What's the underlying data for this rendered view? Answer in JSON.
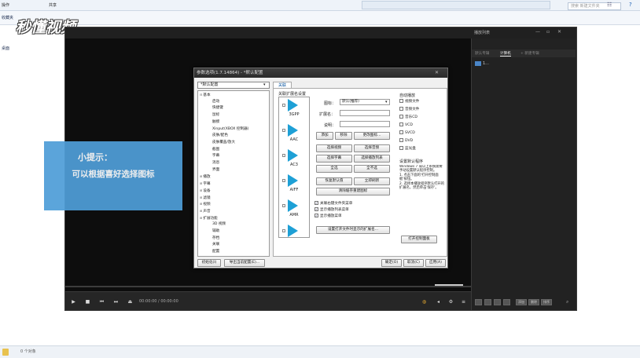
{
  "explorer": {
    "tab_left": "操作",
    "tab_mid": "共享",
    "nav_fav": "收藏夹",
    "nav_desktop": "桌面",
    "search_placeholder": "搜索 新建文件夹",
    "status": "0 个对象"
  },
  "watermark": "秒懂视频",
  "player": {
    "time": "00:00:00 / 00:00:00",
    "playlist_header": "播放列表",
    "playlist_tabs": [
      "默认专辑",
      "计算机",
      "+ 新建专辑"
    ],
    "playlist_item": "1...",
    "pl_buttons": [
      "添加",
      "删除",
      "排序"
    ]
  },
  "dialog": {
    "title": "参数选项(1.7.14864) - *默认配置",
    "preset": "*默认配置",
    "tree": [
      {
        "label": "基本",
        "cls": "open"
      },
      {
        "label": "启动",
        "cls": ""
      },
      {
        "label": "快捷键",
        "cls": ""
      },
      {
        "label": "鼠标",
        "cls": ""
      },
      {
        "label": "触摸",
        "cls": ""
      },
      {
        "label": "Xinput(XBOX 控制器)",
        "cls": ""
      },
      {
        "label": "皮肤/配色",
        "cls": ""
      },
      {
        "label": "皮肤覆盖/放大",
        "cls": ""
      },
      {
        "label": "截图",
        "cls": ""
      },
      {
        "label": "字幕",
        "cls": ""
      },
      {
        "label": "消息",
        "cls": ""
      },
      {
        "label": "界面",
        "cls": ""
      },
      {
        "label": "播放",
        "cls": "top"
      },
      {
        "label": "字幕",
        "cls": "top"
      },
      {
        "label": "设备",
        "cls": "top"
      },
      {
        "label": "滤镜",
        "cls": "top"
      },
      {
        "label": "视频",
        "cls": "top"
      },
      {
        "label": "声音",
        "cls": "top"
      },
      {
        "label": "扩展功能",
        "cls": "top"
      },
      {
        "label": "3D 视频",
        "cls": ""
      },
      {
        "label": "辅助",
        "cls": ""
      },
      {
        "label": "存档",
        "cls": ""
      },
      {
        "label": "关联",
        "cls": ""
      },
      {
        "label": "配置",
        "cls": ""
      }
    ],
    "tab_label": "关联",
    "assoc_header": "关联扩展名设置",
    "extensions": [
      "3GPP",
      "AAC",
      "AC3",
      "AIFF",
      "AMR",
      "AMV"
    ],
    "icon_label": "图标：",
    "icon_value": "默认(推荐)",
    "ext_label": "扩展名：",
    "desc_label": "说明：",
    "buttons_row1": [
      "添加",
      "移除",
      "更改图标..."
    ],
    "buttons_row2": [
      "选择视频",
      "选择音频"
    ],
    "buttons_row3": [
      "选择字幕",
      "选择播放列表"
    ],
    "buttons_row4": [
      "全选",
      "全不选"
    ],
    "buttons_row5": [
      "恢复默认值",
      "立即刷新"
    ],
    "clear_cache": "清除缓存重建图标",
    "checks": [
      "关联右键文件夹菜单",
      "显示播放列表菜单",
      "显示播放菜单"
    ],
    "set_open_btn": "设置打开文件时显示的扩展名...",
    "autoplay_header": "自动播放",
    "autoplay": [
      "视频文件",
      "音频文件",
      "音乐CD",
      "VCD",
      "SVCD",
      "DVD",
      "蓝光盘"
    ],
    "default_header": "设置默认程序",
    "default_text": "Windows 7 或以上系统需要手动设置默认程序控制。\n1. 点击下面的'打开控制面板'按钮。\n2. 选择本播放程序默认打开的扩展名，然后单击'保存'。",
    "open_panel": "打开控制面板",
    "init": "初始化(I)",
    "export": "导出当前配置(E)...",
    "ok": "确定(O)",
    "cancel": "取消(C)",
    "apply": "应用(A)"
  },
  "hint": {
    "title": "小提示：",
    "text": "可以根据喜好选择图标"
  }
}
